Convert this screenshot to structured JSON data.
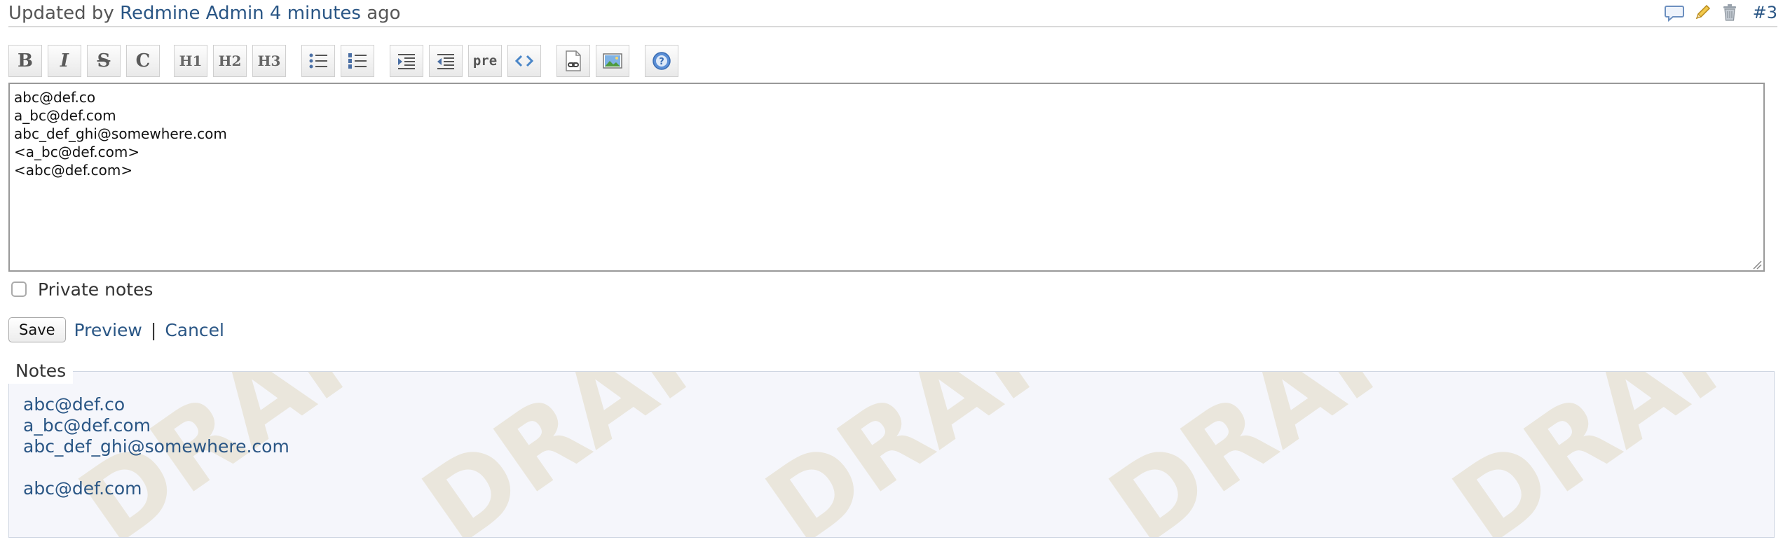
{
  "header": {
    "updated_prefix": "Updated by",
    "author": "Redmine Admin",
    "time_ago": "4 minutes",
    "ago_suffix": "ago",
    "journal_number": "#3",
    "action_icons": [
      "comment-icon",
      "edit-icon",
      "delete-icon"
    ]
  },
  "toolbar": {
    "buttons": [
      {
        "name": "bold-button",
        "label": "B",
        "icon": "bold-icon"
      },
      {
        "name": "italic-button",
        "label": "I",
        "icon": "italic-icon"
      },
      {
        "name": "strikethrough-button",
        "label": "S",
        "icon": "strikethrough-icon"
      },
      {
        "name": "code-button",
        "label": "C",
        "icon": "inline-code-icon"
      },
      {
        "name": "heading-1-button",
        "label": "H1",
        "icon": "heading-1-icon"
      },
      {
        "name": "heading-2-button",
        "label": "H2",
        "icon": "heading-2-icon"
      },
      {
        "name": "heading-3-button",
        "label": "H3",
        "icon": "heading-3-icon"
      },
      {
        "name": "unordered-list-button",
        "icon": "bulleted-list-icon"
      },
      {
        "name": "ordered-list-button",
        "icon": "numbered-list-icon"
      },
      {
        "name": "indent-button",
        "icon": "indent-icon"
      },
      {
        "name": "outdent-button",
        "icon": "outdent-icon"
      },
      {
        "name": "preformatted-button",
        "label": "pre",
        "icon": "preformatted-icon"
      },
      {
        "name": "highlighted-code-button",
        "icon": "code-brackets-icon"
      },
      {
        "name": "link-button",
        "icon": "link-page-icon"
      },
      {
        "name": "image-button",
        "icon": "image-icon"
      },
      {
        "name": "help-button",
        "icon": "help-icon"
      }
    ]
  },
  "editor": {
    "value": "abc@def.co\na_bc@def.com\nabc_def_ghi@somewhere.com\n<a_bc@def.com>\n<abc@def.com>"
  },
  "private_notes": {
    "label": "Private notes",
    "checked": false
  },
  "actions": {
    "save_label": "Save",
    "preview_label": "Preview",
    "separator": "|",
    "cancel_label": "Cancel"
  },
  "preview": {
    "legend": "Notes",
    "lines": [
      "abc@def.co",
      "a_bc@def.com",
      "abc_def_ghi@somewhere.com",
      "",
      "abc@def.com"
    ],
    "watermark": "DRAFT"
  },
  "colors": {
    "link": "#2a5685",
    "preview_background": "#f5f6fb",
    "watermark": "#eae6dc"
  }
}
